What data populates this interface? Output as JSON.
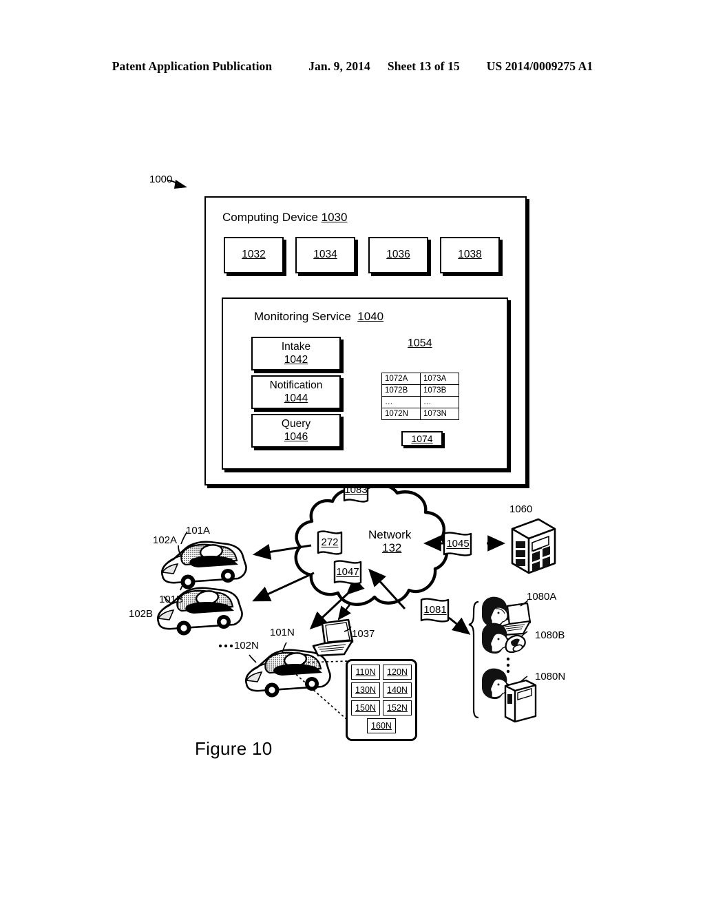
{
  "header": {
    "publication": "Patent Application Publication",
    "date": "Jan. 9, 2014",
    "sheet": "Sheet 13 of 15",
    "docnum": "US 2014/0009275 A1"
  },
  "figure": {
    "caption": "Figure 10",
    "system_ref": "1000",
    "computing_device": {
      "title": "Computing Device",
      "ref": "1030",
      "components": [
        {
          "ref": "1032"
        },
        {
          "ref": "1034"
        },
        {
          "ref": "1036"
        },
        {
          "ref": "1038"
        }
      ],
      "monitoring_service": {
        "title": "Monitoring Service",
        "ref": "1040",
        "modules": [
          {
            "label": "Intake",
            "ref": "1042"
          },
          {
            "label": "Notification",
            "ref": "1044"
          },
          {
            "label": "Query",
            "ref": "1046"
          }
        ],
        "datastore": {
          "ref": "1054",
          "rows": [
            [
              "1072A",
              "1073A"
            ],
            [
              "1072B",
              "1073B"
            ],
            [
              "…",
              "…"
            ],
            [
              "1072N",
              "1073N"
            ]
          ],
          "footer_ref": "1074"
        }
      }
    },
    "network": {
      "label": "Network",
      "ref": "132",
      "flags": [
        {
          "ref": "1083",
          "name": "flag-1083"
        },
        {
          "ref": "272",
          "name": "flag-272"
        },
        {
          "ref": "1047",
          "name": "flag-1047"
        },
        {
          "ref": "1045",
          "name": "flag-1045"
        },
        {
          "ref": "1081",
          "name": "flag-1081"
        }
      ]
    },
    "vehicles": [
      {
        "vehicle_ref": "102A",
        "unit_ref": "101A"
      },
      {
        "vehicle_ref": "102B",
        "unit_ref": "101B"
      },
      {
        "vehicle_ref": "102N",
        "unit_ref": "101N"
      }
    ],
    "vehicles_ellipsis": "•••",
    "server": {
      "ref": "1060"
    },
    "laptop": {
      "ref": "1037"
    },
    "mobile_panel": {
      "cells": [
        [
          "110N",
          "120N"
        ],
        [
          "130N",
          "140N"
        ],
        [
          "150N",
          "152N"
        ]
      ],
      "footer_cell": "160N"
    },
    "users": [
      {
        "ref": "1080A",
        "device": "laptop"
      },
      {
        "ref": "1080B",
        "device": "mobile-phone"
      },
      {
        "ref": "1080N",
        "device": "desktop-tower"
      }
    ],
    "users_ellipsis": "⋮"
  }
}
